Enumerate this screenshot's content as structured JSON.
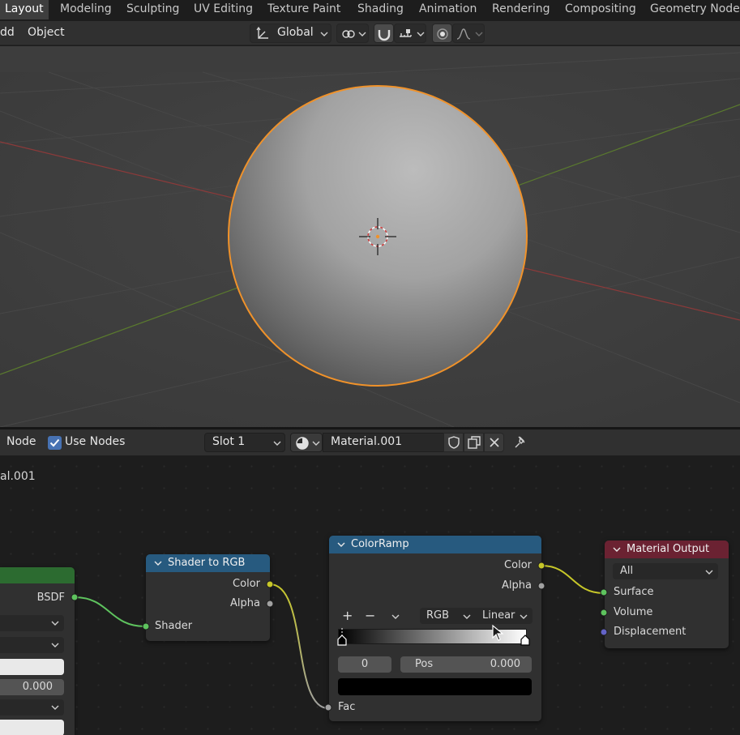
{
  "workspace_tabs": [
    "Layout",
    "Modeling",
    "Sculpting",
    "UV Editing",
    "Texture Paint",
    "Shading",
    "Animation",
    "Rendering",
    "Compositing",
    "Geometry Nodes"
  ],
  "viewport_header": {
    "menu_add": "dd",
    "menu_object": "Object",
    "transform_orientation": "Global"
  },
  "node_header": {
    "menu_node": "Node",
    "use_nodes_label": "Use Nodes",
    "slot": "Slot 1",
    "material_name": "Material.001"
  },
  "breadcrumb": "al.001",
  "nodes": {
    "bsdf": {
      "output_label": "BSDF",
      "value": "0.000"
    },
    "shader_to_rgb": {
      "title": "Shader to RGB",
      "out_color": "Color",
      "out_alpha": "Alpha",
      "in_shader": "Shader"
    },
    "color_ramp": {
      "title": "ColorRamp",
      "out_color": "Color",
      "out_alpha": "Alpha",
      "add_symbol": "+",
      "remove_symbol": "−",
      "color_mode": "RGB",
      "interpolation": "Linear",
      "active_stop": "0",
      "pos_label": "Pos",
      "pos_value": "0.000",
      "in_fac": "Fac"
    },
    "material_output": {
      "title": "Material Output",
      "target": "All",
      "in_surface": "Surface",
      "in_volume": "Volume",
      "in_displacement": "Displacement"
    }
  },
  "colors": {
    "selection_outline": "#f0922a",
    "shader_header": "#275a7f",
    "output_header": "#6b2232",
    "bsdf_header": "#2c6b30",
    "socket_shader": "#5ec35e",
    "socket_color": "#c7c729",
    "socket_float": "#a1a1a1",
    "socket_vector": "#6363c7"
  }
}
